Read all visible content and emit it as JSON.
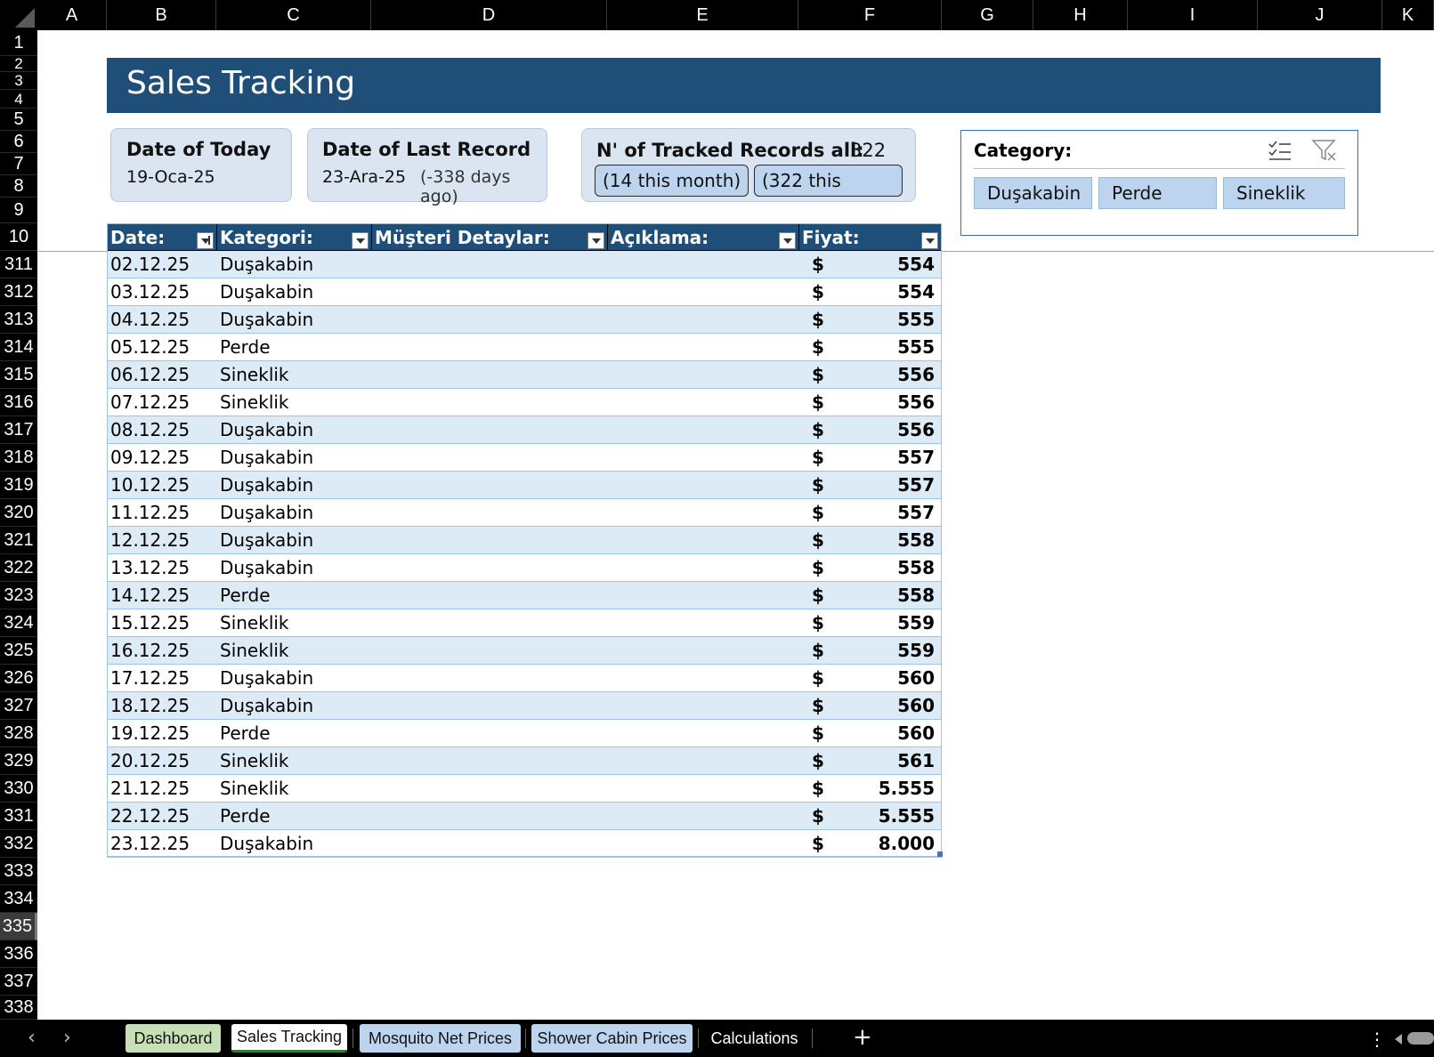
{
  "columns": [
    "A",
    "B",
    "C",
    "D",
    "E",
    "F",
    "G",
    "H",
    "I",
    "J",
    "K"
  ],
  "rows_top": [
    "1",
    "2",
    "3",
    "4",
    "5",
    "6",
    "7",
    "8",
    "9",
    "10"
  ],
  "rows_body": [
    "311",
    "312",
    "313",
    "314",
    "315",
    "316",
    "317",
    "318",
    "319",
    "320",
    "321",
    "322",
    "323",
    "324",
    "325",
    "326",
    "327",
    "328",
    "329",
    "330",
    "331",
    "332"
  ],
  "rows_bottom": [
    "333",
    "334",
    "335",
    "336",
    "337",
    "338"
  ],
  "title": "Sales Tracking",
  "cards": {
    "today": {
      "title": "Date of Today",
      "value": "19-Oca-25"
    },
    "last_record": {
      "title": "Date of Last Record",
      "value": "23-Ara-25",
      "note": "(-338 days ago)"
    },
    "tracked": {
      "title": "N' of Tracked Records all:",
      "count": "322",
      "pill_month": "(14 this month)",
      "pill_year": "(322 this"
    }
  },
  "slicer": {
    "title": "Category:",
    "icons": [
      "multi-select-icon",
      "clear-filter-icon"
    ],
    "items": [
      "Duşakabin",
      "Perde",
      "Sineklik"
    ]
  },
  "table": {
    "headers": [
      "Date:",
      "Kategori:",
      "Müşteri Detaylar:",
      "Açıklama:",
      "Fiyat:"
    ],
    "currency": "$",
    "rows": [
      {
        "date": "02.12.25",
        "category": "Duşakabin",
        "price": "554"
      },
      {
        "date": "03.12.25",
        "category": "Duşakabin",
        "price": "554"
      },
      {
        "date": "04.12.25",
        "category": "Duşakabin",
        "price": "555"
      },
      {
        "date": "05.12.25",
        "category": "Perde",
        "price": "555"
      },
      {
        "date": "06.12.25",
        "category": "Sineklik",
        "price": "556"
      },
      {
        "date": "07.12.25",
        "category": "Sineklik",
        "price": "556"
      },
      {
        "date": "08.12.25",
        "category": "Duşakabin",
        "price": "556"
      },
      {
        "date": "09.12.25",
        "category": "Duşakabin",
        "price": "557"
      },
      {
        "date": "10.12.25",
        "category": "Duşakabin",
        "price": "557"
      },
      {
        "date": "11.12.25",
        "category": "Duşakabin",
        "price": "557"
      },
      {
        "date": "12.12.25",
        "category": "Duşakabin",
        "price": "558"
      },
      {
        "date": "13.12.25",
        "category": "Duşakabin",
        "price": "558"
      },
      {
        "date": "14.12.25",
        "category": "Perde",
        "price": "558"
      },
      {
        "date": "15.12.25",
        "category": "Sineklik",
        "price": "559"
      },
      {
        "date": "16.12.25",
        "category": "Sineklik",
        "price": "559"
      },
      {
        "date": "17.12.25",
        "category": "Duşakabin",
        "price": "560"
      },
      {
        "date": "18.12.25",
        "category": "Duşakabin",
        "price": "560"
      },
      {
        "date": "19.12.25",
        "category": "Perde",
        "price": "560"
      },
      {
        "date": "20.12.25",
        "category": "Sineklik",
        "price": "561"
      },
      {
        "date": "21.12.25",
        "category": "Sineklik",
        "price": "5.555"
      },
      {
        "date": "22.12.25",
        "category": "Perde",
        "price": "5.555"
      },
      {
        "date": "23.12.25",
        "category": "Duşakabin",
        "price": "8.000"
      }
    ]
  },
  "tabs": {
    "nav_prev": "‹",
    "nav_next": "›",
    "items": [
      "Dashboard",
      "Sales Tracking",
      "Mosquito Net Prices",
      "Shower Cabin Prices",
      "Calculations"
    ],
    "active": "Sales Tracking",
    "add": "+",
    "more": "⋮"
  },
  "colors": {
    "title_band": "#1f4e79",
    "card_bg": "#dbe5f1",
    "row_band": "#ddebf7",
    "slicer_item": "#bdd4ee",
    "tab_dashboard": "#c6e0b4"
  }
}
